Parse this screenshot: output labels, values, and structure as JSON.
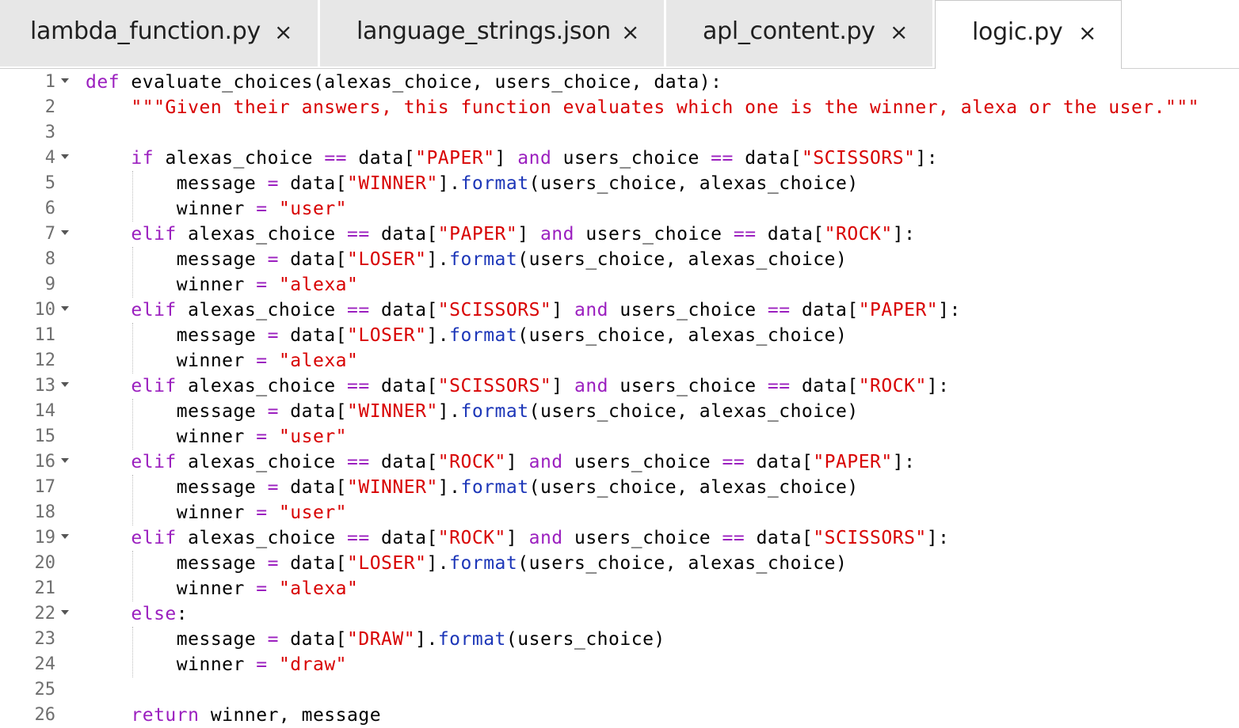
{
  "tabs": [
    {
      "label": "lambda_function.py",
      "close": "×",
      "active": false
    },
    {
      "label": "language_strings.json",
      "close": "×",
      "active": false
    },
    {
      "label": "apl_content.py",
      "close": "×",
      "active": false
    },
    {
      "label": "logic.py",
      "close": "×",
      "active": true
    }
  ],
  "editor": {
    "lines": [
      {
        "n": "1",
        "fold": true,
        "tokens": [
          [
            "kw",
            "def"
          ],
          [
            "t",
            " evaluate_choices(alexas_choice, users_choice, data):"
          ]
        ]
      },
      {
        "n": "2",
        "fold": false,
        "tokens": [
          [
            "t",
            "    "
          ],
          [
            "str",
            "\"\"\"Given their answers, this function evaluates which one is the winner, alexa or the user.\"\"\""
          ]
        ]
      },
      {
        "n": "3",
        "fold": false,
        "tokens": []
      },
      {
        "n": "4",
        "fold": true,
        "tokens": [
          [
            "t",
            "    "
          ],
          [
            "kw",
            "if"
          ],
          [
            "t",
            " alexas_choice "
          ],
          [
            "op",
            "=="
          ],
          [
            "t",
            " data["
          ],
          [
            "str",
            "\"PAPER\""
          ],
          [
            "t",
            "] "
          ],
          [
            "kw",
            "and"
          ],
          [
            "t",
            " users_choice "
          ],
          [
            "op",
            "=="
          ],
          [
            "t",
            " data["
          ],
          [
            "str",
            "\"SCISSORS\""
          ],
          [
            "t",
            "]:"
          ]
        ]
      },
      {
        "n": "5",
        "fold": false,
        "tokens": [
          [
            "t",
            "        message "
          ],
          [
            "op",
            "="
          ],
          [
            "t",
            " data["
          ],
          [
            "str",
            "\"WINNER\""
          ],
          [
            "t",
            "]."
          ],
          [
            "fn",
            "format"
          ],
          [
            "t",
            "(users_choice, alexas_choice)"
          ]
        ]
      },
      {
        "n": "6",
        "fold": false,
        "tokens": [
          [
            "t",
            "        winner "
          ],
          [
            "op",
            "="
          ],
          [
            "t",
            " "
          ],
          [
            "str",
            "\"user\""
          ]
        ]
      },
      {
        "n": "7",
        "fold": true,
        "tokens": [
          [
            "t",
            "    "
          ],
          [
            "kw",
            "elif"
          ],
          [
            "t",
            " alexas_choice "
          ],
          [
            "op",
            "=="
          ],
          [
            "t",
            " data["
          ],
          [
            "str",
            "\"PAPER\""
          ],
          [
            "t",
            "] "
          ],
          [
            "kw",
            "and"
          ],
          [
            "t",
            " users_choice "
          ],
          [
            "op",
            "=="
          ],
          [
            "t",
            " data["
          ],
          [
            "str",
            "\"ROCK\""
          ],
          [
            "t",
            "]:"
          ]
        ]
      },
      {
        "n": "8",
        "fold": false,
        "tokens": [
          [
            "t",
            "        message "
          ],
          [
            "op",
            "="
          ],
          [
            "t",
            " data["
          ],
          [
            "str",
            "\"LOSER\""
          ],
          [
            "t",
            "]."
          ],
          [
            "fn",
            "format"
          ],
          [
            "t",
            "(users_choice, alexas_choice)"
          ]
        ]
      },
      {
        "n": "9",
        "fold": false,
        "tokens": [
          [
            "t",
            "        winner "
          ],
          [
            "op",
            "="
          ],
          [
            "t",
            " "
          ],
          [
            "str",
            "\"alexa\""
          ]
        ]
      },
      {
        "n": "10",
        "fold": true,
        "tokens": [
          [
            "t",
            "    "
          ],
          [
            "kw",
            "elif"
          ],
          [
            "t",
            " alexas_choice "
          ],
          [
            "op",
            "=="
          ],
          [
            "t",
            " data["
          ],
          [
            "str",
            "\"SCISSORS\""
          ],
          [
            "t",
            "] "
          ],
          [
            "kw",
            "and"
          ],
          [
            "t",
            " users_choice "
          ],
          [
            "op",
            "=="
          ],
          [
            "t",
            " data["
          ],
          [
            "str",
            "\"PAPER\""
          ],
          [
            "t",
            "]:"
          ]
        ]
      },
      {
        "n": "11",
        "fold": false,
        "tokens": [
          [
            "t",
            "        message "
          ],
          [
            "op",
            "="
          ],
          [
            "t",
            " data["
          ],
          [
            "str",
            "\"LOSER\""
          ],
          [
            "t",
            "]."
          ],
          [
            "fn",
            "format"
          ],
          [
            "t",
            "(users_choice, alexas_choice)"
          ]
        ]
      },
      {
        "n": "12",
        "fold": false,
        "tokens": [
          [
            "t",
            "        winner "
          ],
          [
            "op",
            "="
          ],
          [
            "t",
            " "
          ],
          [
            "str",
            "\"alexa\""
          ]
        ]
      },
      {
        "n": "13",
        "fold": true,
        "tokens": [
          [
            "t",
            "    "
          ],
          [
            "kw",
            "elif"
          ],
          [
            "t",
            " alexas_choice "
          ],
          [
            "op",
            "=="
          ],
          [
            "t",
            " data["
          ],
          [
            "str",
            "\"SCISSORS\""
          ],
          [
            "t",
            "] "
          ],
          [
            "kw",
            "and"
          ],
          [
            "t",
            " users_choice "
          ],
          [
            "op",
            "=="
          ],
          [
            "t",
            " data["
          ],
          [
            "str",
            "\"ROCK\""
          ],
          [
            "t",
            "]:"
          ]
        ]
      },
      {
        "n": "14",
        "fold": false,
        "tokens": [
          [
            "t",
            "        message "
          ],
          [
            "op",
            "="
          ],
          [
            "t",
            " data["
          ],
          [
            "str",
            "\"WINNER\""
          ],
          [
            "t",
            "]."
          ],
          [
            "fn",
            "format"
          ],
          [
            "t",
            "(users_choice, alexas_choice)"
          ]
        ]
      },
      {
        "n": "15",
        "fold": false,
        "tokens": [
          [
            "t",
            "        winner "
          ],
          [
            "op",
            "="
          ],
          [
            "t",
            " "
          ],
          [
            "str",
            "\"user\""
          ]
        ]
      },
      {
        "n": "16",
        "fold": true,
        "tokens": [
          [
            "t",
            "    "
          ],
          [
            "kw",
            "elif"
          ],
          [
            "t",
            " alexas_choice "
          ],
          [
            "op",
            "=="
          ],
          [
            "t",
            " data["
          ],
          [
            "str",
            "\"ROCK\""
          ],
          [
            "t",
            "] "
          ],
          [
            "kw",
            "and"
          ],
          [
            "t",
            " users_choice "
          ],
          [
            "op",
            "=="
          ],
          [
            "t",
            " data["
          ],
          [
            "str",
            "\"PAPER\""
          ],
          [
            "t",
            "]:"
          ]
        ]
      },
      {
        "n": "17",
        "fold": false,
        "tokens": [
          [
            "t",
            "        message "
          ],
          [
            "op",
            "="
          ],
          [
            "t",
            " data["
          ],
          [
            "str",
            "\"WINNER\""
          ],
          [
            "t",
            "]."
          ],
          [
            "fn",
            "format"
          ],
          [
            "t",
            "(users_choice, alexas_choice)"
          ]
        ]
      },
      {
        "n": "18",
        "fold": false,
        "tokens": [
          [
            "t",
            "        winner "
          ],
          [
            "op",
            "="
          ],
          [
            "t",
            " "
          ],
          [
            "str",
            "\"user\""
          ]
        ]
      },
      {
        "n": "19",
        "fold": true,
        "tokens": [
          [
            "t",
            "    "
          ],
          [
            "kw",
            "elif"
          ],
          [
            "t",
            " alexas_choice "
          ],
          [
            "op",
            "=="
          ],
          [
            "t",
            " data["
          ],
          [
            "str",
            "\"ROCK\""
          ],
          [
            "t",
            "] "
          ],
          [
            "kw",
            "and"
          ],
          [
            "t",
            " users_choice "
          ],
          [
            "op",
            "=="
          ],
          [
            "t",
            " data["
          ],
          [
            "str",
            "\"SCISSORS\""
          ],
          [
            "t",
            "]:"
          ]
        ]
      },
      {
        "n": "20",
        "fold": false,
        "tokens": [
          [
            "t",
            "        message "
          ],
          [
            "op",
            "="
          ],
          [
            "t",
            " data["
          ],
          [
            "str",
            "\"LOSER\""
          ],
          [
            "t",
            "]."
          ],
          [
            "fn",
            "format"
          ],
          [
            "t",
            "(users_choice, alexas_choice)"
          ]
        ]
      },
      {
        "n": "21",
        "fold": false,
        "tokens": [
          [
            "t",
            "        winner "
          ],
          [
            "op",
            "="
          ],
          [
            "t",
            " "
          ],
          [
            "str",
            "\"alexa\""
          ]
        ]
      },
      {
        "n": "22",
        "fold": true,
        "tokens": [
          [
            "t",
            "    "
          ],
          [
            "kw",
            "else"
          ],
          [
            "t",
            ":"
          ]
        ]
      },
      {
        "n": "23",
        "fold": false,
        "tokens": [
          [
            "t",
            "        message "
          ],
          [
            "op",
            "="
          ],
          [
            "t",
            " data["
          ],
          [
            "str",
            "\"DRAW\""
          ],
          [
            "t",
            "]."
          ],
          [
            "fn",
            "format"
          ],
          [
            "t",
            "(users_choice)"
          ]
        ]
      },
      {
        "n": "24",
        "fold": false,
        "tokens": [
          [
            "t",
            "        winner "
          ],
          [
            "op",
            "="
          ],
          [
            "t",
            " "
          ],
          [
            "str",
            "\"draw\""
          ]
        ]
      },
      {
        "n": "25",
        "fold": false,
        "tokens": []
      },
      {
        "n": "26",
        "fold": false,
        "tokens": [
          [
            "t",
            "    "
          ],
          [
            "kw",
            "return"
          ],
          [
            "t",
            " winner, message"
          ]
        ]
      }
    ]
  },
  "colors": {
    "keyword": "#9b1fbf",
    "string": "#d80000",
    "function": "#1c36b8",
    "text": "#000000",
    "gutter": "#6f6f6f",
    "tab_inactive": "#e7e7e7",
    "tab_active": "#ffffff"
  }
}
